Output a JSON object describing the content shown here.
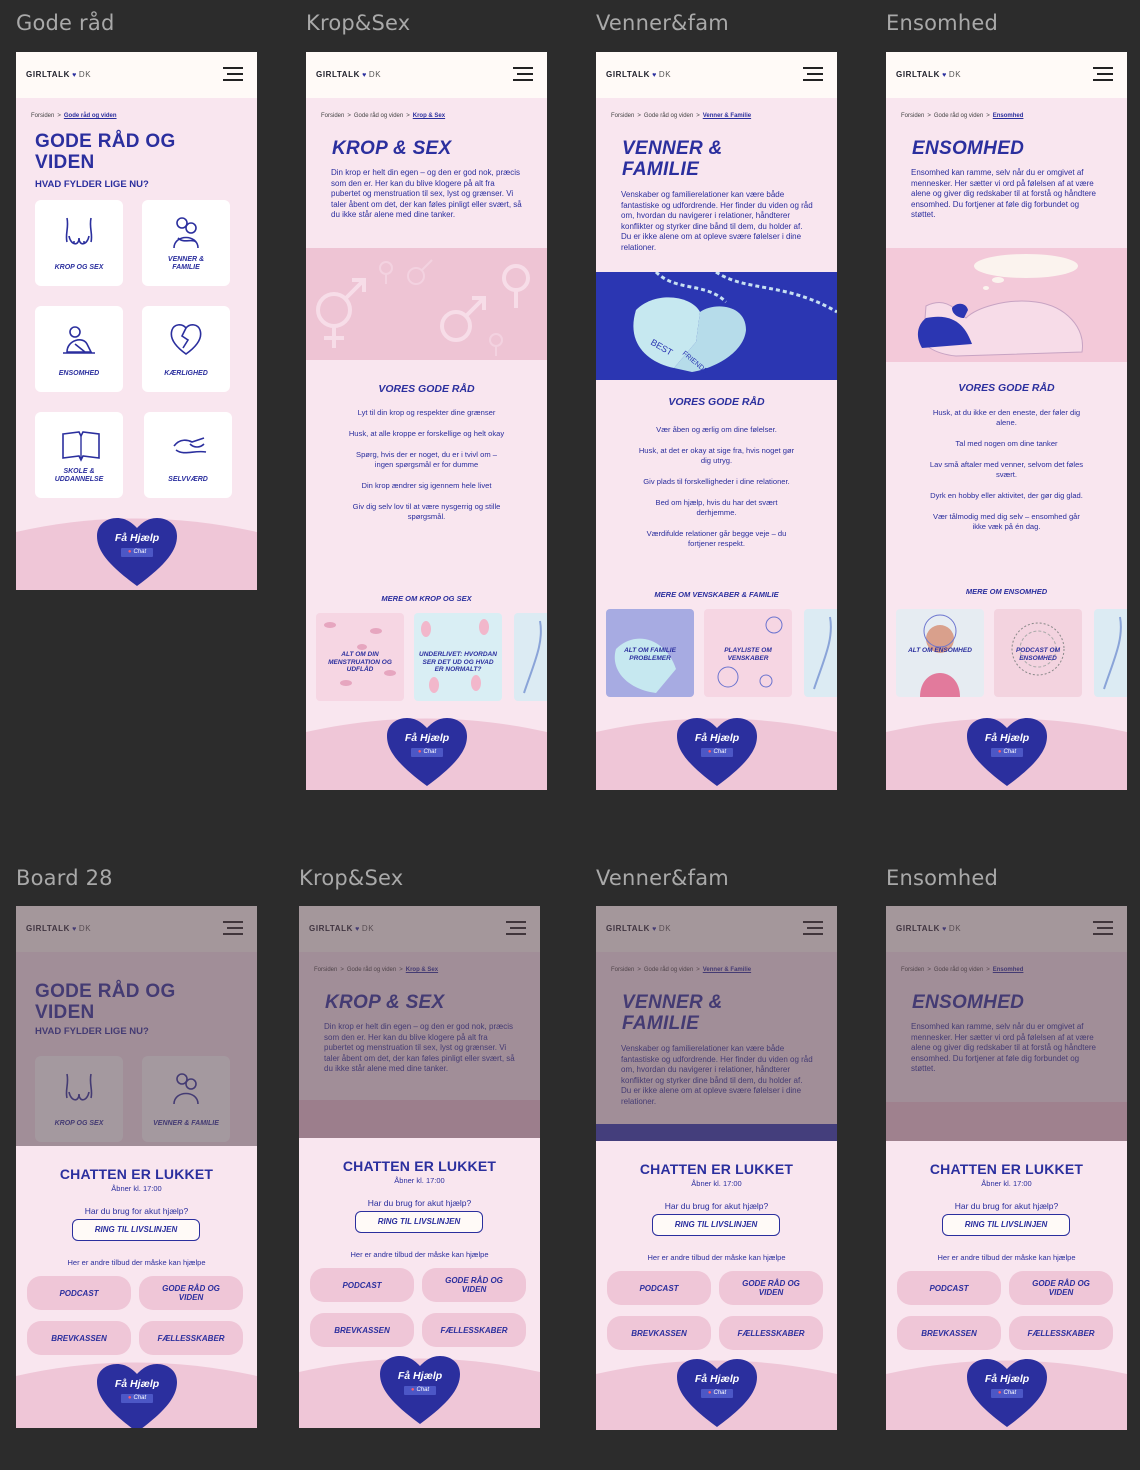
{
  "boards": [
    {
      "title": "Gode råd"
    },
    {
      "title": "Krop&Sex"
    },
    {
      "title": "Venner&fam"
    },
    {
      "title": "Ensomhed"
    },
    {
      "title": "Board 28"
    },
    {
      "title": "Krop&Sex"
    },
    {
      "title": "Venner&fam"
    },
    {
      "title": "Ensomhed"
    }
  ],
  "common": {
    "logo_name": "GIRLTALK",
    "logo_heart": "♥",
    "logo_country": "DK",
    "crumb_home": "Forsiden",
    "crumb_sep": ">",
    "crumb_advice": "Gode råd og viden",
    "help_title": "Få Hjælp",
    "help_chat": "Chat",
    "tips_heading": "VORES GODE RÅD"
  },
  "gode_raad": {
    "title_line1": "GODE RÅD OG",
    "title_line2": "VIDEN",
    "subtitle": "HVAD FYLDER LIGE NU?",
    "tiles": [
      {
        "line1": "KROP OG SEX",
        "line2": ""
      },
      {
        "line1": "VENNER &",
        "line2": "FAMILIE"
      },
      {
        "line1": "ENSOMHED",
        "line2": ""
      },
      {
        "line1": "KÆRLIGHED",
        "line2": ""
      },
      {
        "line1": "SKOLE &",
        "line2": "UDDANNELSE"
      },
      {
        "line1": "SELVVÆRD",
        "line2": ""
      }
    ]
  },
  "krop_sex": {
    "crumb": "Krop & Sex",
    "title": "KROP & SEX",
    "intro": "Din krop er helt din egen – og den er god nok, præcis som den er. Her kan du blive klogere på alt fra pubertet og menstruation til sex, lyst og grænser. Vi taler åbent om det, der kan føles pinligt eller svært, så du ikke står alene med dine tanker.",
    "tips": [
      "Lyt til din krop og respekter dine grænser",
      "Husk, at alle kroppe er forskellige og helt okay",
      "Spørg, hvis der er noget, du er i tvivl om – ingen spørgsmål er for dumme",
      "Din krop ændrer sig igennem hele livet",
      "Giv dig selv lov til at være nysgerrig og stille spørgsmål."
    ],
    "more_heading": "MERE OM KROP OG SEX",
    "cards": [
      "ALT OM DIN MENSTRUATION OG UDFLÅD",
      "UNDERLIVET: HVORDAN SER DET UD OG HVAD ER NORMALT?"
    ]
  },
  "venner": {
    "crumb": "Venner & Familie",
    "title_line1": "VENNER &",
    "title_line2": "FAMILIE",
    "intro": "Venskaber og familierelationer kan være både fantastiske og udfordrende. Her finder du viden og råd om, hvordan du navigerer i relationer, håndterer konflikter og styrker dine bånd til dem, du holder af. Du er ikke alene om at opleve svære følelser i dine relationer.",
    "tips": [
      "Vær åben og ærlig om dine følelser.",
      "Husk, at det er okay at sige fra, hvis noget gør dig utryg.",
      "Giv plads til forskelligheder i dine relationer.",
      "Bed om hjælp, hvis du har det svært derhjemme.",
      "Værdifulde relationer går begge veje – du fortjener respekt."
    ],
    "more_heading": "MERE OM VENSKABER & FAMILIE",
    "cards": [
      "ALT OM FAMILIE PROBLEMER",
      "PLAYLISTE OM VENSKABER"
    ],
    "image_text_1": "BEST",
    "image_text_2": "FRIENDS"
  },
  "ensomhed": {
    "crumb": "Ensomhed",
    "title": "ENSOMHED",
    "intro": "Ensomhed kan ramme, selv når du er omgivet af mennesker. Her sætter vi ord på følelsen af at være alene og giver dig redskaber til at forstå og håndtere ensomhed. Du fortjener at føle dig forbundet og støttet.",
    "tips": [
      "Husk, at du ikke er den eneste, der føler dig alene.",
      "Tal med nogen om dine tanker",
      "Lav små aftaler med venner, selvom det føles svært.",
      "Dyrk en hobby eller aktivitet, der gør dig glad.",
      "Vær tålmodig med dig selv – ensomhed går ikke væk på én dag."
    ],
    "more_heading": "MERE OM ENSOMHED",
    "cards": [
      "ALT OM ENSOMHED",
      "PODCAST OM ENSOMHED"
    ]
  },
  "closed": {
    "heading": "CHATTEN ER LUKKET",
    "opens": "Åbner kl. 17:00",
    "need_help": "Har du brug for akut hjælp?",
    "ring": "RING TIL LIVSLINJEN",
    "other": "Her er andre tilbud der måske kan hjælpe",
    "offers": [
      {
        "line1": "PODCAST",
        "line2": ""
      },
      {
        "line1": "GODE RÅD OG",
        "line2": "VIDEN"
      },
      {
        "line1": "BREVKASSEN",
        "line2": ""
      },
      {
        "line1": "FÆLLESSKABER",
        "line2": ""
      }
    ]
  },
  "colors": {
    "brand_blue": "#2b2f9e",
    "bg_pink": "#f9e6ef",
    "pink_dark": "#efc6d7",
    "canvas": "#2c2c2c"
  }
}
